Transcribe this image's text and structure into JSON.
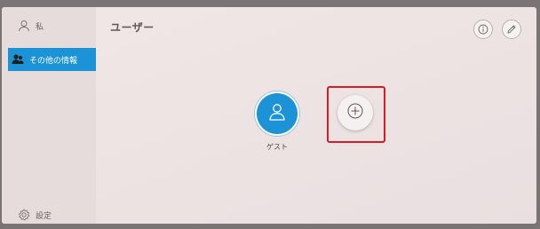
{
  "sidebar": {
    "items": [
      {
        "label": "私",
        "icon": "person-outline-icon"
      },
      {
        "label": "その他の情報",
        "icon": "people-icon",
        "selected": true
      },
      {
        "label": "設定",
        "icon": "gear-icon"
      }
    ]
  },
  "main": {
    "title": "ユーザー",
    "toolbar": {
      "info_icon": "info-icon",
      "edit_icon": "pencil-icon"
    },
    "users": [
      {
        "label": "ゲスト",
        "icon": "person-outline-icon",
        "color": "#1b93d6"
      }
    ],
    "add_button": {
      "icon": "plus-circle-icon",
      "highlight_color": "#d81b25"
    }
  },
  "colors": {
    "accent": "#1b93d6",
    "background": "#efe5e5",
    "highlight": "#d81b25"
  }
}
